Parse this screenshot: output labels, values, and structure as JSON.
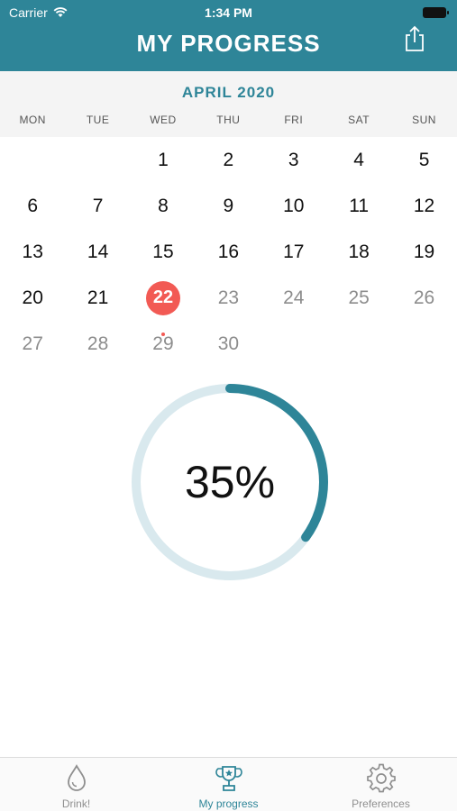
{
  "status": {
    "carrier": "Carrier",
    "time": "1:34 PM"
  },
  "header": {
    "title": "MY PROGRESS",
    "share_icon": "share-icon"
  },
  "calendar": {
    "month": "APRIL 2020",
    "weekdays": [
      "MON",
      "TUE",
      "WED",
      "THU",
      "FRI",
      "SAT",
      "SUN"
    ],
    "weeks": [
      [
        "",
        "",
        "1",
        "2",
        "3",
        "4",
        "5"
      ],
      [
        "6",
        "7",
        "8",
        "9",
        "10",
        "11",
        "12"
      ],
      [
        "13",
        "14",
        "15",
        "16",
        "17",
        "18",
        "19"
      ],
      [
        "20",
        "21",
        "22",
        "23",
        "24",
        "25",
        "26"
      ],
      [
        "27",
        "28",
        "29",
        "30",
        "",
        "",
        ""
      ]
    ],
    "selected_day": "22",
    "marked_day": "29",
    "selected_color": "#f25a54"
  },
  "progress": {
    "label": "35%",
    "value": 0.35,
    "track_color": "#d9e9ee",
    "fill_color": "#2e8598"
  },
  "tabs": [
    {
      "label": "Drink!",
      "icon": "drop-icon",
      "active": false
    },
    {
      "label": "My progress",
      "icon": "trophy-icon",
      "active": true
    },
    {
      "label": "Preferences",
      "icon": "gear-icon",
      "active": false
    }
  ]
}
